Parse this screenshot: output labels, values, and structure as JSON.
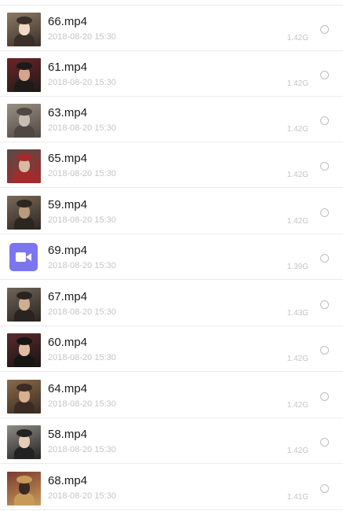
{
  "files": [
    {
      "name": "66.mp4",
      "date": "2018-08-20 15:30",
      "size": "1.42G",
      "thumbnail": "video-frame",
      "palette": [
        "#8c7a66",
        "#3b2f27",
        "#f1d9c6"
      ]
    },
    {
      "name": "61.mp4",
      "date": "2018-08-20 15:30",
      "size": "1.42G",
      "thumbnail": "video-frame",
      "palette": [
        "#6b2524",
        "#1e1a1a",
        "#d4a48c"
      ]
    },
    {
      "name": "63.mp4",
      "date": "2018-08-20 15:30",
      "size": "1.42G",
      "thumbnail": "video-frame",
      "palette": [
        "#9a8f84",
        "#4f4842",
        "#c8bdb4"
      ]
    },
    {
      "name": "65.mp4",
      "date": "2018-08-20 15:30",
      "size": "1.42G",
      "thumbnail": "video-frame",
      "palette": [
        "#5a4a45",
        "#a52a2a",
        "#d9b99f"
      ]
    },
    {
      "name": "59.mp4",
      "date": "2018-08-20 15:30",
      "size": "1.42G",
      "thumbnail": "video-frame",
      "palette": [
        "#7a6a58",
        "#2c2621",
        "#b89a7c"
      ]
    },
    {
      "name": "69.mp4",
      "date": "2018-08-20 15:30",
      "size": "1.39G",
      "thumbnail": "video-icon",
      "palette": [
        "#7b76f0",
        "#ffffff",
        "#ffffff"
      ]
    },
    {
      "name": "67.mp4",
      "date": "2018-08-20 15:30",
      "size": "1.43G",
      "thumbnail": "video-frame",
      "palette": [
        "#6f6458",
        "#2a2420",
        "#cfae93"
      ]
    },
    {
      "name": "60.mp4",
      "date": "2018-08-20 15:30",
      "size": "1.42G",
      "thumbnail": "video-frame",
      "palette": [
        "#5b2b2b",
        "#171414",
        "#e0bca4"
      ]
    },
    {
      "name": "64.mp4",
      "date": "2018-08-20 15:30",
      "size": "1.42G",
      "thumbnail": "video-frame",
      "palette": [
        "#8a6a4a",
        "#3a2c22",
        "#d7b08f"
      ]
    },
    {
      "name": "58.mp4",
      "date": "2018-08-20 15:30",
      "size": "1.42G",
      "thumbnail": "video-frame",
      "palette": [
        "#8f8c86",
        "#222222",
        "#e6cbb6"
      ]
    },
    {
      "name": "68.mp4",
      "date": "2018-08-20 15:30",
      "size": "1.41G",
      "thumbnail": "video-frame",
      "palette": [
        "#7a3a2e",
        "#c79a5a",
        "#3b2a22"
      ]
    }
  ]
}
